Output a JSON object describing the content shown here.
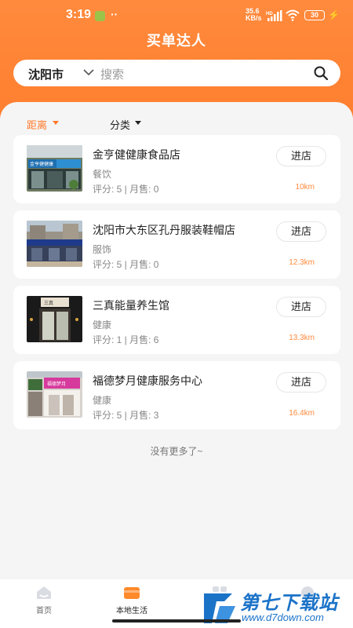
{
  "status_bar": {
    "time": "3:19",
    "extra": "··",
    "net_speed_top": "35.6",
    "net_speed_bottom": "KB/s",
    "hd": "HD",
    "battery": "30"
  },
  "header": {
    "title": "买单达人"
  },
  "search": {
    "city": "沈阳市",
    "placeholder": "搜索"
  },
  "filters": {
    "distance": "距离",
    "category": "分类"
  },
  "stores": [
    {
      "name": "金亨健健康食品店",
      "category": "餐饮",
      "stats": "评分: 5 | 月售: 0",
      "distance": "10km",
      "button": "进店",
      "sign_text": "金亨健健康"
    },
    {
      "name": "沈阳市大东区孔丹服装鞋帽店",
      "category": "服饰",
      "stats": "评分: 5 | 月售: 0",
      "distance": "12.3km",
      "button": "进店",
      "sign_text": ""
    },
    {
      "name": "三真能量养生馆",
      "category": "健康",
      "stats": "评分: 1 | 月售: 6",
      "distance": "13.3km",
      "button": "进店",
      "sign_text": "三真"
    },
    {
      "name": "福德梦月健康服务中心",
      "category": "健康",
      "stats": "评分: 5 | 月售: 3",
      "distance": "16.4km",
      "button": "进店",
      "sign_text": "福德梦月"
    }
  ],
  "list_footer": "没有更多了~",
  "tabs": [
    {
      "label": "首页",
      "icon": "home-icon"
    },
    {
      "label": "本地生活",
      "icon": "wallet-icon"
    },
    {
      "label": "",
      "icon": "grid-icon"
    },
    {
      "label": "",
      "icon": "user-icon"
    }
  ],
  "watermark": {
    "title": "第七下载站",
    "url": "www.d7down.com"
  },
  "colors": {
    "accent": "#ff7f2f",
    "distance": "#ff8a3d",
    "watermark": "#1b73c8"
  }
}
